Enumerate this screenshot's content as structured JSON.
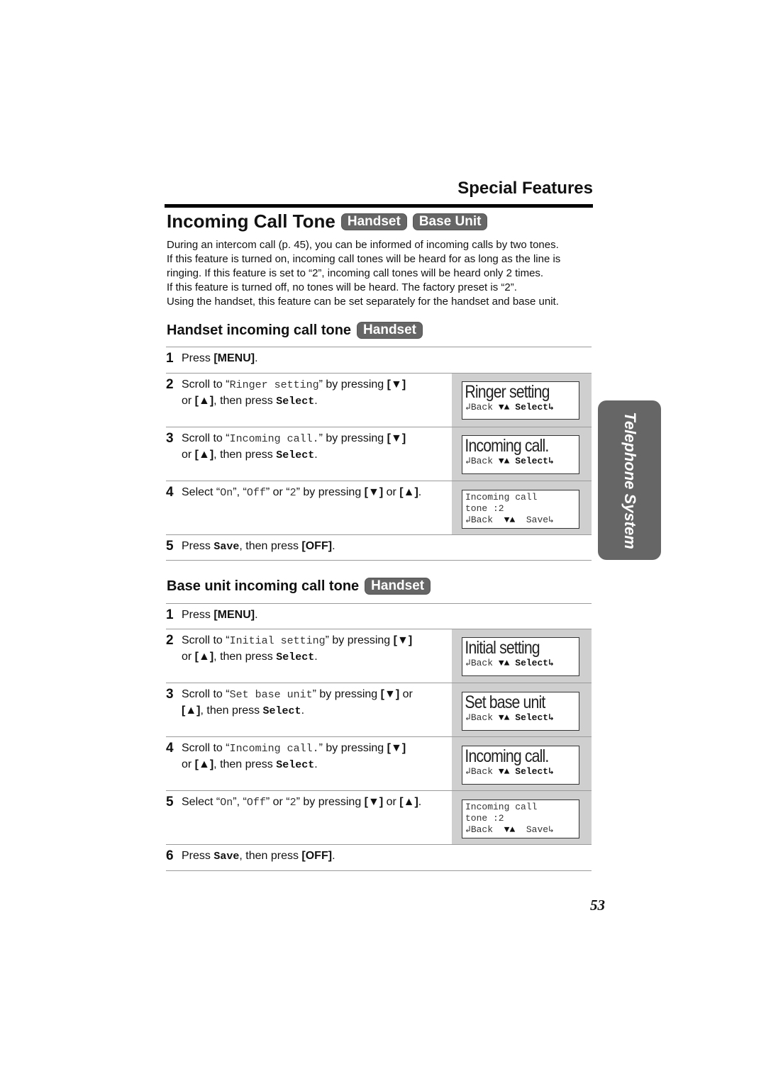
{
  "header": {
    "section": "Special Features"
  },
  "title": {
    "text": "Incoming Call Tone",
    "badges": [
      "Handset",
      "Base Unit"
    ]
  },
  "intro": [
    "During an intercom call (p. 45), you can be informed of incoming calls by two tones.",
    "If this feature is turned on, incoming call tones will be heard for as long as the line is",
    "ringing. If this feature is set to “2”, incoming call tones will be heard only 2 times.",
    "If this feature is turned off, no tones will be heard. The factory preset is “2”.",
    "Using the handset, this feature can be set separately for the handset and base unit."
  ],
  "side_tab": {
    "label": "Telephone System"
  },
  "page_number": "53",
  "common": {
    "press": "Press ",
    "menu_key": "[MENU]",
    "period": ".",
    "scroll_to": "Scroll to “",
    "by_pressing": "” by pressing ",
    "down_key": "[▼]",
    "up_key": "[▲]",
    "or": " or ",
    "then_press": ", then press ",
    "select_soft": "Select",
    "save_soft": "Save",
    "then_press_off": ", then press ",
    "off_key": "[OFF]",
    "select_q": "Select “",
    "on": "On",
    "off": "Off",
    "two": "2",
    "q_sep": "”, “",
    "q_or": "” or “",
    "q_by": "” by pressing ",
    "soft_back": "↲Back",
    "soft_arrows": "▼▲",
    "soft_select": "Select↳",
    "soft_save": "Save↳"
  },
  "handset_section": {
    "heading": "Handset incoming call tone",
    "badge": "Handset",
    "steps": [
      {
        "num": "1"
      },
      {
        "num": "2",
        "item": "Ringer setting",
        "lcd": "Ringer setting"
      },
      {
        "num": "3",
        "item": "Incoming call.",
        "lcd": "Incoming call."
      },
      {
        "num": "4",
        "lcd_lines": [
          "Incoming call",
          "tone :2"
        ]
      },
      {
        "num": "5"
      }
    ]
  },
  "base_section": {
    "heading": "Base unit incoming call tone",
    "badge": "Handset",
    "steps": [
      {
        "num": "1"
      },
      {
        "num": "2",
        "item": "Initial setting",
        "lcd": "Initial setting"
      },
      {
        "num": "3",
        "item": "Set base unit",
        "lcd": "Set base unit"
      },
      {
        "num": "4",
        "item": "Incoming call.",
        "lcd": "Incoming call."
      },
      {
        "num": "5",
        "lcd_lines": [
          "Incoming call",
          "tone :2"
        ]
      },
      {
        "num": "6"
      }
    ]
  }
}
